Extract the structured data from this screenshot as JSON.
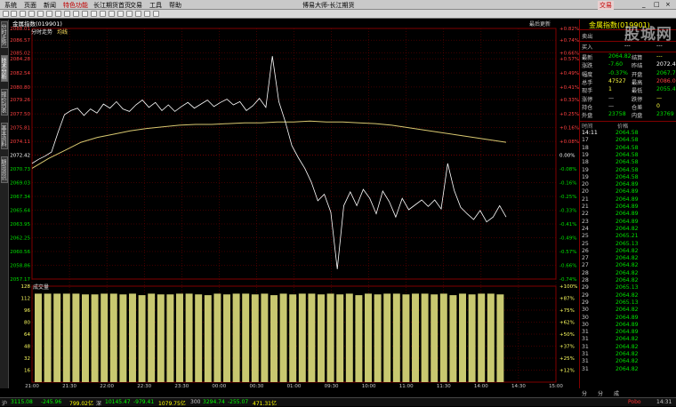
{
  "menubar": {
    "items": [
      "系统",
      "页面",
      "新闻",
      "特色功能",
      "长江期货首页",
      "交易",
      "工具",
      "帮助"
    ],
    "title": "博易大师-长江期货"
  },
  "top_right": {
    "trade": "交易",
    "minimize": "_",
    "maximize": "□",
    "close": "×"
  },
  "leftbar": {
    "tabs": [
      "分时走势",
      "技术分析",
      "报价列表",
      "基本资料",
      "期货资讯"
    ]
  },
  "chart": {
    "header": "金属指数(019901)",
    "subheader": "分时走势",
    "subheader_extra": "均线",
    "top_right": "最后更新",
    "price_ticks": [
      "2088.01",
      "2086.57",
      "2085.02",
      "2084.28",
      "2082.54",
      "2080.80",
      "2079.26",
      "2077.50",
      "2075.81",
      "2074.11",
      "2072.42",
      "2070.73",
      "2069.03",
      "2067.34",
      "2065.64",
      "2063.95",
      "2062.25",
      "2060.56",
      "2058.86",
      "2057.17"
    ],
    "pct_ticks": [
      "+0.82%",
      "+0.74%",
      "+0.66%",
      "+0.57%",
      "+0.49%",
      "+0.41%",
      "+0.33%",
      "+0.25%",
      "+0.16%",
      "+0.08%",
      "0.00%",
      "-0.08%",
      "-0.16%",
      "-0.25%",
      "-0.33%",
      "-0.41%",
      "-0.49%",
      "-0.57%",
      "-0.66%",
      "-0.74%"
    ],
    "volume_label": "成交量",
    "vol_ticks": [
      "128",
      "112",
      "96",
      "80",
      "64",
      "48",
      "32",
      "16"
    ],
    "vol_pct_ticks": [
      "+100%",
      "+87%",
      "+75%",
      "+62%",
      "+50%",
      "+37%",
      "+25%",
      "+12%"
    ],
    "time_ticks": [
      "21:00",
      "21:30",
      "22:00",
      "22:30",
      "23:30",
      "00:00",
      "00:30",
      "01:00",
      "09:30",
      "10:00",
      "11:00",
      "11:30",
      "14:00",
      "14:30",
      "15:00"
    ]
  },
  "chart_data": {
    "type": "line",
    "title": "金属指数(019901)",
    "reference_price": 2072.42,
    "ylim": [
      2057.17,
      2088.01
    ],
    "x_labels": [
      "21:00",
      "21:30",
      "22:00",
      "22:30",
      "23:30",
      "00:00",
      "00:30",
      "01:00",
      "09:30",
      "10:00",
      "11:00",
      "11:30",
      "14:00",
      "14:30",
      "15:00"
    ],
    "series": [
      {
        "name": "分时",
        "values": [
          2071.4,
          2071.9,
          2072.3,
          2072.8,
          2075.2,
          2077.4,
          2077.9,
          2078.2,
          2077.3,
          2078.1,
          2077.6,
          2078.7,
          2078.2,
          2079.0,
          2078.1,
          2077.8,
          2078.6,
          2079.2,
          2078.3,
          2078.9,
          2077.9,
          2078.6,
          2077.8,
          2078.4,
          2078.9,
          2078.2,
          2078.7,
          2079.2,
          2078.4,
          2078.9,
          2079.3,
          2078.6,
          2079.0,
          2077.9,
          2078.5,
          2079.4,
          2078.3,
          2084.6,
          2079.0,
          2076.5,
          2073.6,
          2072.1,
          2070.8,
          2069.1,
          2066.8,
          2067.6,
          2065.4,
          2058.4,
          2066.2,
          2067.9,
          2066.2,
          2068.2,
          2067.1,
          2065.2,
          2068.0,
          2066.7,
          2064.8,
          2067.1,
          2065.7,
          2066.3,
          2066.9,
          2066.1,
          2066.9,
          2065.8,
          2071.4,
          2068.1,
          2066.0,
          2065.2,
          2064.5,
          2065.6,
          2064.2,
          2064.8,
          2066.2,
          2064.8
        ]
      },
      {
        "name": "均线",
        "values": [
          2070.8,
          2072.0,
          2073.0,
          2074.0,
          2074.6,
          2075.0,
          2075.4,
          2075.7,
          2075.9,
          2076.1,
          2076.2,
          2076.2,
          2076.3,
          2076.4,
          2076.4,
          2076.5,
          2076.5,
          2076.6,
          2076.5,
          2076.5,
          2076.4,
          2076.3,
          2076.1,
          2075.8,
          2075.5,
          2075.2,
          2074.9,
          2074.6,
          2074.3,
          2074.0
        ]
      }
    ],
    "volume": {
      "values": [
        118,
        118,
        118,
        118,
        118,
        117,
        117,
        118,
        118,
        117,
        118,
        116,
        118,
        117,
        117,
        118,
        118,
        117,
        116,
        118,
        117,
        118,
        118,
        117,
        118,
        116,
        118,
        117,
        118,
        118,
        117,
        118,
        117,
        118,
        116,
        118,
        117,
        118,
        118,
        117,
        118,
        118,
        117,
        118,
        116,
        118,
        117,
        118,
        118,
        117
      ],
      "ylim": [
        0,
        128
      ]
    }
  },
  "rightpanel": {
    "title": "金属指数(019901)",
    "sell_label": "卖出",
    "sell_val": "---",
    "sell_vol": "---",
    "buy_label": "买入",
    "buy_val": "---",
    "buy_vol": "---",
    "stats": [
      {
        "l1": "最新",
        "v1": "2064.82",
        "l2": "结算",
        "v2": "---"
      },
      {
        "l1": "涨跌",
        "v1": "-7.60",
        "l2": "昨结",
        "v2": "2072.42"
      },
      {
        "l1": "幅度",
        "v1": "-0.37%",
        "l2": "开盘",
        "v2": "2067.71"
      },
      {
        "l1": "总手",
        "v1": "47527",
        "l2": "最高",
        "v2": "2086.02"
      },
      {
        "l1": "现手",
        "v1": "1",
        "l2": "最低",
        "v2": "2055.47"
      },
      {
        "l1": "涨停",
        "v1": "—",
        "l2": "跌停",
        "v2": "—"
      },
      {
        "l1": "持仓",
        "v1": "—",
        "l2": "仓差",
        "v2": "0"
      },
      {
        "l1": "外盘",
        "v1": "23758",
        "l2": "内盘",
        "v2": "23769"
      }
    ],
    "ticks_header": {
      "time": "时间",
      "price": "价格"
    },
    "ticks": [
      {
        "t": "14:11",
        "p": "2064.58"
      },
      {
        "t": "17",
        "p": "2064.58"
      },
      {
        "t": "18",
        "p": "2064.58"
      },
      {
        "t": "19",
        "p": "2064.58"
      },
      {
        "t": "18",
        "p": "2064.58"
      },
      {
        "t": "19",
        "p": "2064.58"
      },
      {
        "t": "19",
        "p": "2064.58"
      },
      {
        "t": "20",
        "p": "2064.89"
      },
      {
        "t": "20",
        "p": "2064.89"
      },
      {
        "t": "21",
        "p": "2064.89"
      },
      {
        "t": "21",
        "p": "2064.89"
      },
      {
        "t": "22",
        "p": "2064.89"
      },
      {
        "t": "23",
        "p": "2064.89"
      },
      {
        "t": "24",
        "p": "2064.82"
      },
      {
        "t": "25",
        "p": "2065.21"
      },
      {
        "t": "25",
        "p": "2065.13"
      },
      {
        "t": "26",
        "p": "2064.82"
      },
      {
        "t": "27",
        "p": "2064.82"
      },
      {
        "t": "27",
        "p": "2064.82"
      },
      {
        "t": "28",
        "p": "2064.82"
      },
      {
        "t": "28",
        "p": "2064.82"
      },
      {
        "t": "29",
        "p": "2065.13"
      },
      {
        "t": "29",
        "p": "2064.82"
      },
      {
        "t": "29",
        "p": "2065.13"
      },
      {
        "t": "30",
        "p": "2064.82"
      },
      {
        "t": "30",
        "p": "2064.89"
      },
      {
        "t": "30",
        "p": "2064.89"
      },
      {
        "t": "31",
        "p": "2064.89"
      },
      {
        "t": "31",
        "p": "2064.82"
      },
      {
        "t": "31",
        "p": "2064.82"
      },
      {
        "t": "31",
        "p": "2064.82"
      },
      {
        "t": "31",
        "p": "2064.82"
      },
      {
        "t": "31",
        "p": "2064.82"
      }
    ]
  },
  "subtabs": [
    "分笔",
    "分价",
    "成交"
  ],
  "statusbar": {
    "items": [
      {
        "label": "沪",
        "value": "3115.08",
        "color": "#00ff00"
      },
      {
        "label": "",
        "value": "-245.96",
        "color": "#00ff00"
      },
      {
        "label": "",
        "value": "799.02亿",
        "color": "#ffff00"
      },
      {
        "label": "深",
        "value": "10145.47",
        "color": "#00ff00"
      },
      {
        "label": "",
        "value": "-979.41",
        "color": "#00ff00"
      },
      {
        "label": "",
        "value": "1079.75亿",
        "color": "#ffff00"
      },
      {
        "label": "300",
        "value": "3294.74",
        "color": "#00ff00"
      },
      {
        "label": "",
        "value": "-255.07",
        "color": "#00ff00"
      },
      {
        "label": "",
        "value": "471.31亿",
        "color": "#ffff00"
      }
    ],
    "right": "Pobo",
    "clock": "14:31"
  },
  "watermark": "股城网"
}
